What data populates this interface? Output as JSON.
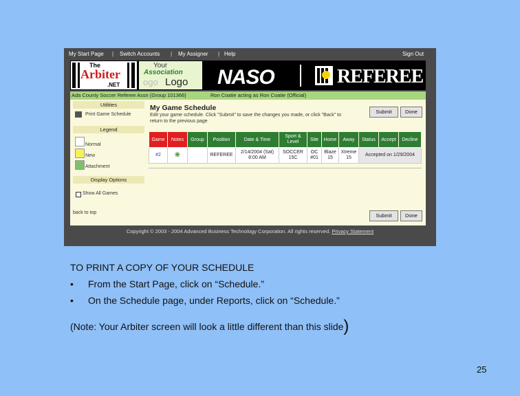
{
  "nav": {
    "items": [
      "My Start Page",
      "Switch Accounts",
      "My Assigner",
      "Help"
    ],
    "sign_out": "Sign Out"
  },
  "banner": {
    "arbiter_logo": {
      "line1": "The",
      "line2": "Arbiter",
      "line3": ".NET"
    },
    "assoc_logo": {
      "line1": "Your",
      "line2": "Association",
      "line3": "Logo",
      "ghost": "ogo"
    },
    "naso": "NASO",
    "referee": "REFEREE"
  },
  "account_bar": {
    "group": "Ada County Soccer Referee Assn (Group 101366)",
    "user": "Ron Coatie acting as Ron Coatie (Official)"
  },
  "sidebar": {
    "utilities_title": "Utilities",
    "print_label": "Print Game Schedule",
    "legend_title": "Legend",
    "legend": [
      {
        "label": "Normal",
        "color": "#ffffff"
      },
      {
        "label": "New",
        "color": "#f5f15a"
      },
      {
        "label": "Attachment",
        "color": "#7fc06a"
      }
    ],
    "display_title": "Display Options",
    "show_all": "Show All Games",
    "back": "back to top"
  },
  "main": {
    "title": "My Game Schedule",
    "instructions": "Edit your game schedule. Click \"Submit\" to save the changes you made, or click \"Back\" to return to the previous page",
    "submit": "Submit",
    "done": "Done"
  },
  "table": {
    "headers": [
      "Game",
      "Notes",
      "Group",
      "Position",
      "Date & Time",
      "Sport & Level",
      "Site",
      "Home",
      "Away",
      "Status",
      "Accept",
      "Decline"
    ],
    "red_headers": [
      0,
      1
    ],
    "row": {
      "game": "#2",
      "notes_icon": "leaf-icon",
      "group": "",
      "position": "REFEREE",
      "date_line1": "2/14/2004 (Sat)",
      "date_line2": "8:00 AM",
      "sport_line1": "SOCCER",
      "sport_line2": "15C",
      "site_line1": "OC",
      "site_line2": "#01",
      "home_line1": "Blaze",
      "home_line2": "15",
      "away_line1": "Xtreme",
      "away_line2": "15",
      "status": "Accepted on 1/29/2004"
    }
  },
  "footer": {
    "copyright": "Copyright © 2003 - 2004 Advanced Business Technology Corporation. All rights reserved.",
    "privacy": "Privacy Statement"
  },
  "slide": {
    "heading": "TO PRINT A COPY OF YOUR SCHEDULE",
    "bullet_char": "•",
    "bullets": [
      "From the Start Page, click on “Schedule.”",
      "On the Schedule page, under Reports, click on “Schedule.”"
    ],
    "note": "(Note: Your Arbiter screen will look a little different than this slide",
    "note_close": ")",
    "page": "25"
  },
  "colors": {
    "slide_bg": "#8fc0f8",
    "header_green": "#2e7d32",
    "header_red": "#e02020",
    "account_green": "#a8d67e"
  }
}
